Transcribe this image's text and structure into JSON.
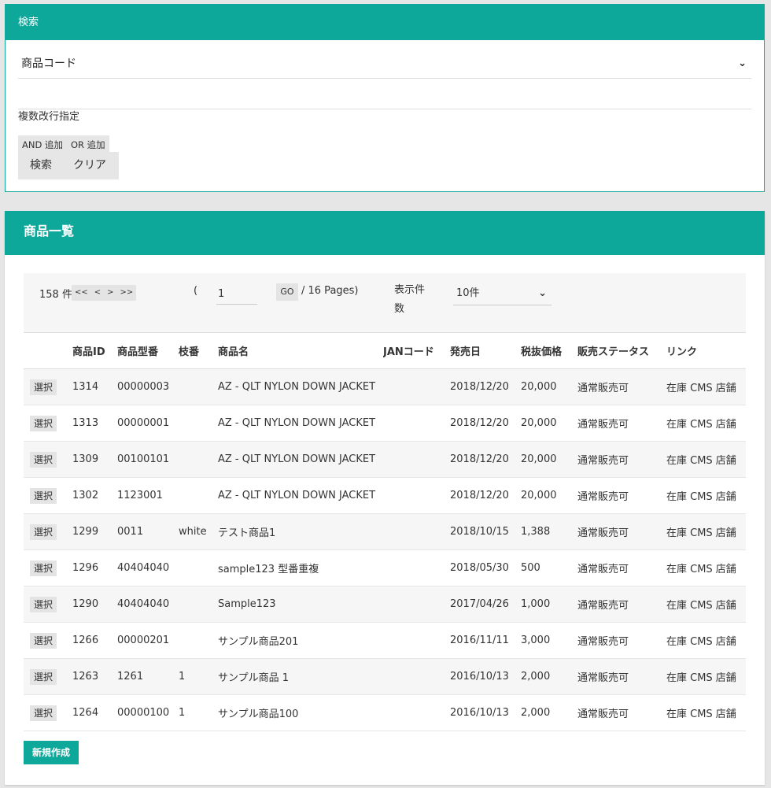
{
  "search": {
    "title": "検索",
    "field_select_value": "商品コード",
    "field_input_value": "",
    "multi_label": "複数改行指定",
    "and_label": "AND 追加",
    "or_label": "OR 追加",
    "search_label": "検索",
    "clear_label": "クリア"
  },
  "list": {
    "title": "商品一覧",
    "pager": {
      "count": "158 件",
      "first": "<<",
      "prev": "<",
      "next": ">",
      "last": ">>",
      "paren": "(",
      "page_value": "1",
      "go": "GO",
      "pages": "/ 16 Pages)",
      "display_label": "表示件数",
      "display_value": "10件"
    },
    "headers": [
      "",
      "商品ID",
      "商品型番",
      "枝番",
      "商品名",
      "JANコード",
      "発売日",
      "税抜価格",
      "販売ステータス",
      "リンク"
    ],
    "select_label": "選択",
    "rows": [
      {
        "id": "1314",
        "model": "00000003",
        "branch": "",
        "name": "AZ - QLT NYLON DOWN JACKET",
        "jan": "",
        "date": "2018/12/20",
        "price": "20,000",
        "status": "通常販売可",
        "link": "在庫 CMS 店舗"
      },
      {
        "id": "1313",
        "model": "00000001",
        "branch": "",
        "name": "AZ - QLT NYLON DOWN JACKET",
        "jan": "",
        "date": "2018/12/20",
        "price": "20,000",
        "status": "通常販売可",
        "link": "在庫 CMS 店舗"
      },
      {
        "id": "1309",
        "model": "00100101",
        "branch": "",
        "name": "AZ - QLT NYLON DOWN JACKET",
        "jan": "",
        "date": "2018/12/20",
        "price": "20,000",
        "status": "通常販売可",
        "link": "在庫 CMS 店舗"
      },
      {
        "id": "1302",
        "model": "1123001",
        "branch": "",
        "name": "AZ - QLT NYLON DOWN JACKET",
        "jan": "",
        "date": "2018/12/20",
        "price": "20,000",
        "status": "通常販売可",
        "link": "在庫 CMS 店舗"
      },
      {
        "id": "1299",
        "model": "0011",
        "branch": "white",
        "name": "テスト商品1",
        "jan": "",
        "date": "2018/10/15",
        "price": "1,388",
        "status": "通常販売可",
        "link": "在庫 CMS 店舗"
      },
      {
        "id": "1296",
        "model": "40404040",
        "branch": "",
        "name": "sample123 型番重複",
        "jan": "",
        "date": "2018/05/30",
        "price": "500",
        "status": "通常販売可",
        "link": "在庫 CMS 店舗"
      },
      {
        "id": "1290",
        "model": "40404040",
        "branch": "",
        "name": "Sample123",
        "jan": "",
        "date": "2017/04/26",
        "price": "1,000",
        "status": "通常販売可",
        "link": "在庫 CMS 店舗"
      },
      {
        "id": "1266",
        "model": "00000201",
        "branch": "",
        "name": "サンプル商品201",
        "jan": "",
        "date": "2016/11/11",
        "price": "3,000",
        "status": "通常販売可",
        "link": "在庫 CMS 店舗"
      },
      {
        "id": "1263",
        "model": "1261",
        "branch": "1",
        "name": "サンプル商品 1",
        "jan": "",
        "date": "2016/10/13",
        "price": "2,000",
        "status": "通常販売可",
        "link": "在庫 CMS 店舗"
      },
      {
        "id": "1264",
        "model": "00000100",
        "branch": "1",
        "name": "サンプル商品100",
        "jan": "",
        "date": "2016/10/13",
        "price": "2,000",
        "status": "通常販売可",
        "link": "在庫 CMS 店舗"
      }
    ],
    "new_label": "新規作成"
  },
  "colors": {
    "accent": "#0ea89b",
    "page_bg": "#e6e6e6"
  },
  "icons": {
    "select_chevron": "chevron-down-icon"
  }
}
